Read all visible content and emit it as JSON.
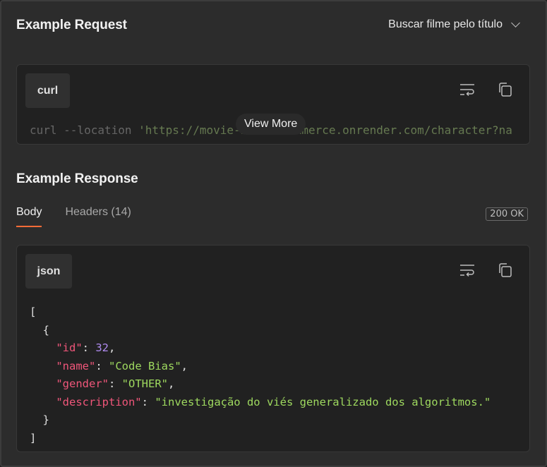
{
  "request": {
    "title": "Example Request",
    "selected_example": "Buscar filme pelo título",
    "language": "curl",
    "code_prefix": "curl --location ",
    "code_url": "'https://movie-bias-ecommerce.onrender.com/character?na",
    "view_more_label": "View More"
  },
  "response": {
    "title": "Example Response",
    "tabs": [
      {
        "label": "Body"
      },
      {
        "label": "Headers (14)"
      }
    ],
    "status": "200 OK",
    "language": "json",
    "json": {
      "open_bracket": "[",
      "open_brace": "{",
      "fields": [
        {
          "key": "\"id\"",
          "value": "32"
        },
        {
          "key": "\"name\"",
          "value": "\"Code Bias\""
        },
        {
          "key": "\"gender\"",
          "value": "\"OTHER\""
        },
        {
          "key": "\"description\"",
          "value": "\"investigação do viés generalizado dos algoritmos.\""
        }
      ],
      "close_brace": "}",
      "close_bracket": "]"
    }
  },
  "icons": {
    "wrap": "wrap-lines-icon",
    "copy": "copy-icon",
    "chevron": "chevron-down-icon"
  },
  "colors": {
    "accent": "#ff6c37",
    "json_key": "#f0567a",
    "json_string": "#9ed95f",
    "json_number": "#b08cf0"
  }
}
